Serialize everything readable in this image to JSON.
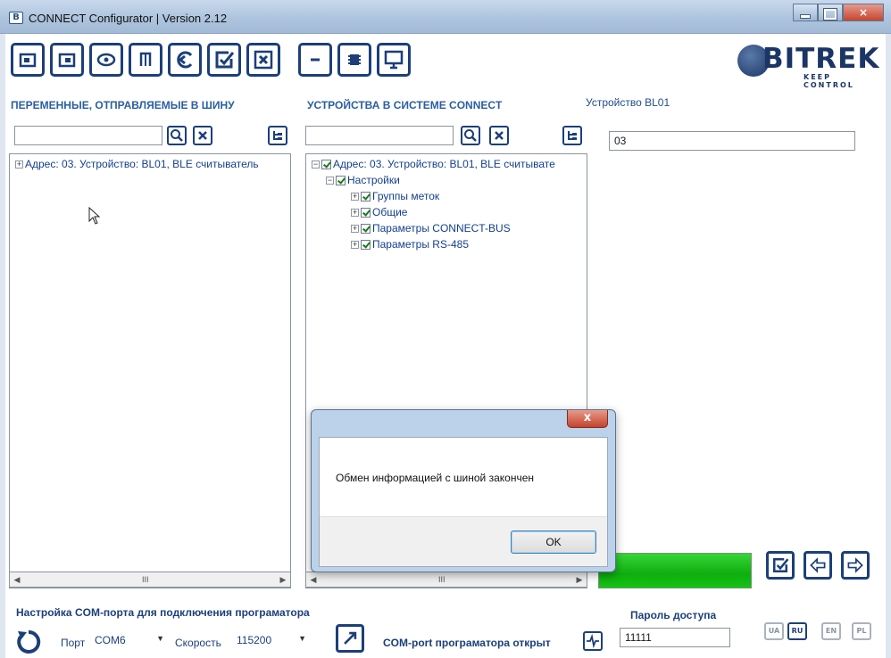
{
  "window": {
    "title": "CONNECT Configurator | Version 2.12",
    "app_icon": "B"
  },
  "logo": {
    "name": "BITREK",
    "tagline": "KEEP CONTROL"
  },
  "toolbar": {
    "icons": [
      "open-file-icon",
      "save-file-icon",
      "view-icon",
      "save-settings-icon",
      "refresh-icon",
      "confirm-icon",
      "cancel-icon",
      "minus-icon",
      "chip-icon",
      "monitor-icon"
    ]
  },
  "left_panel": {
    "heading": "ПЕРЕМЕННЫЕ, ОТПРАВЛЯЕМЫЕ В ШИНУ",
    "search_value": "",
    "tree": [
      {
        "label": "Адрес: 03. Устройство: BL01, BLE считыватель",
        "level": 0,
        "expander": "+",
        "checkbox": false
      }
    ],
    "scroll_grip": "III"
  },
  "middle_panel": {
    "heading": "УСТРОЙСТВА В СИСТЕМЕ CONNECT",
    "search_value": "",
    "tree": [
      {
        "label": "Адрес: 03. Устройство: BL01, BLE считывате",
        "level": 0,
        "expander": "−",
        "checkbox": true
      },
      {
        "label": "Настройки",
        "level": 1,
        "expander": "−",
        "checkbox": true
      },
      {
        "label": "Группы меток",
        "level": 2,
        "expander": "+",
        "checkbox": true
      },
      {
        "label": "Общие",
        "level": 2,
        "expander": "+",
        "checkbox": true
      },
      {
        "label": "Параметры CONNECT-BUS",
        "level": 2,
        "expander": "+",
        "checkbox": true
      },
      {
        "label": "Параметры RS-485",
        "level": 2,
        "expander": "+",
        "checkbox": true
      }
    ],
    "scroll_grip": "III"
  },
  "right_panel": {
    "device_heading": "Устройство BL01",
    "device_address": "03",
    "progress": 1.0,
    "colors": {
      "progress": "#12c312"
    }
  },
  "bottom": {
    "com_heading": "Настройка COM-порта для подключения програматора",
    "port_label": "Порт",
    "port_value": "COM6",
    "speed_label": "Скорость",
    "speed_value": "115200",
    "status": "COM-port програматора открыт",
    "password_heading": "Пароль доступа",
    "password_value": "11111",
    "languages": [
      "UA",
      "RU",
      "EN",
      "PL"
    ],
    "active_language": "RU"
  },
  "dialog": {
    "message": "Обмен информацией с шиной закончен",
    "ok_label": "OK",
    "close_glyph": "x"
  },
  "colors": {
    "accent": "#1c3f7a",
    "heading": "#2a5ea2"
  }
}
